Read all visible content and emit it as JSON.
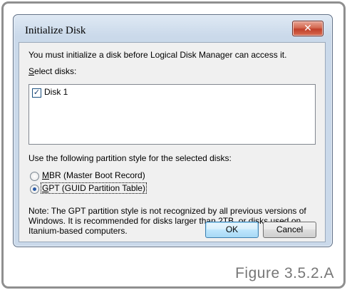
{
  "dialog": {
    "title": "Initialize Disk",
    "close_glyph": "✕"
  },
  "content": {
    "intro_text": "You must initialize a disk before Logical Disk Manager can access it.",
    "select_disks_accel": "S",
    "select_disks_rest": "elect disks:",
    "disks": [
      {
        "label": "Disk 1",
        "checked": true
      }
    ],
    "partition_prompt": "Use the following partition style for the selected disks:",
    "options": [
      {
        "accel": "M",
        "rest": "BR (Master Boot Record)",
        "selected": false
      },
      {
        "accel": "G",
        "rest": "PT (GUID Partition Table)",
        "selected": true
      }
    ],
    "note_line1": "Note: The GPT partition style is not recognized by all previous versions of",
    "note_line2": "Windows. It is recommended for disks larger than 2TB, or disks used on",
    "note_line3": "Itanium-based computers."
  },
  "buttons": {
    "ok_label": "OK",
    "cancel_label": "Cancel"
  },
  "caption": "Figure 3.5.2.A",
  "icons": {
    "close": "close-icon",
    "checkbox": "checkmark-icon"
  }
}
